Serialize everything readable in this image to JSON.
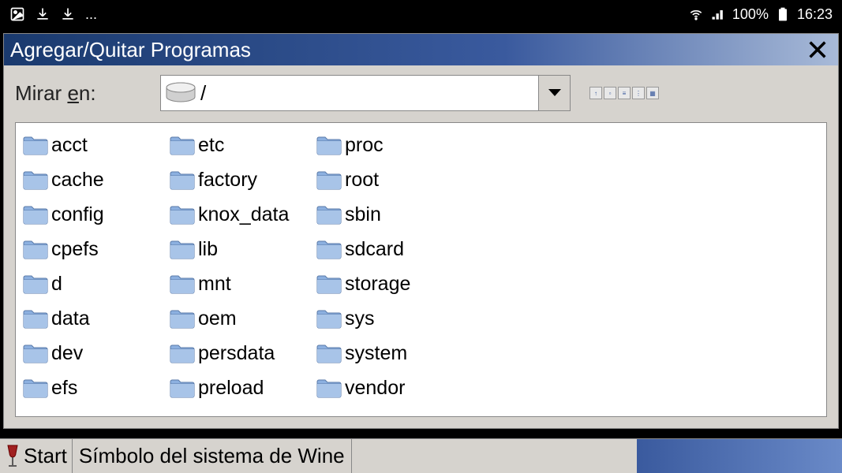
{
  "status": {
    "ellipsis": "...",
    "battery_pct": "100%",
    "time": "16:23"
  },
  "window": {
    "title": "Agregar/Quitar Programas",
    "lookin_label_pre": "Mirar ",
    "lookin_label_u": "e",
    "lookin_label_post": "n:",
    "path": "/",
    "folders": [
      "acct",
      "cache",
      "config",
      "cpefs",
      "d",
      "data",
      "dev",
      "efs",
      "etc",
      "factory",
      "knox_data",
      "lib",
      "mnt",
      "oem",
      "persdata",
      "preload",
      "proc",
      "root",
      "sbin",
      "sdcard",
      "storage",
      "sys",
      "system",
      "vendor"
    ]
  },
  "taskbar": {
    "start": "Start",
    "item1": "Símbolo del sistema de Wine"
  }
}
